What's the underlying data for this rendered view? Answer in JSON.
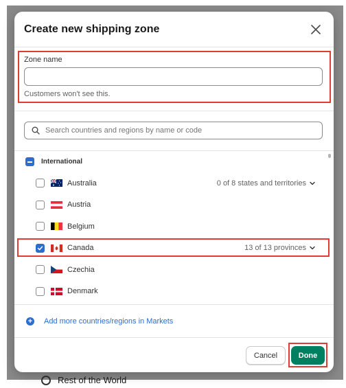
{
  "modal": {
    "title": "Create new shipping zone",
    "zone_name_label": "Zone name",
    "zone_name_value": "",
    "zone_name_help": "Customers won't see this.",
    "search_placeholder": "Search countries and regions by name or code",
    "group_label": "International",
    "countries": [
      {
        "name": "Australia",
        "meta": "0 of 8 states and territories",
        "checked": false,
        "flag": "australia-flag"
      },
      {
        "name": "Austria",
        "meta": "",
        "checked": false,
        "flag": "austria-flag"
      },
      {
        "name": "Belgium",
        "meta": "",
        "checked": false,
        "flag": "belgium-flag"
      },
      {
        "name": "Canada",
        "meta": "13 of 13 provinces",
        "checked": true,
        "flag": "canada-flag"
      },
      {
        "name": "Czechia",
        "meta": "",
        "checked": false,
        "flag": "czechia-flag"
      },
      {
        "name": "Denmark",
        "meta": "",
        "checked": false,
        "flag": "denmark-flag"
      }
    ],
    "add_more_label": "Add more countries/regions in Markets",
    "cancel_label": "Cancel",
    "done_label": "Done"
  },
  "background": {
    "partial_row_label": "Rest of the World"
  },
  "colors": {
    "accent": "#2c6ecb",
    "primary_button": "#008060",
    "highlight": "#e03c31"
  }
}
